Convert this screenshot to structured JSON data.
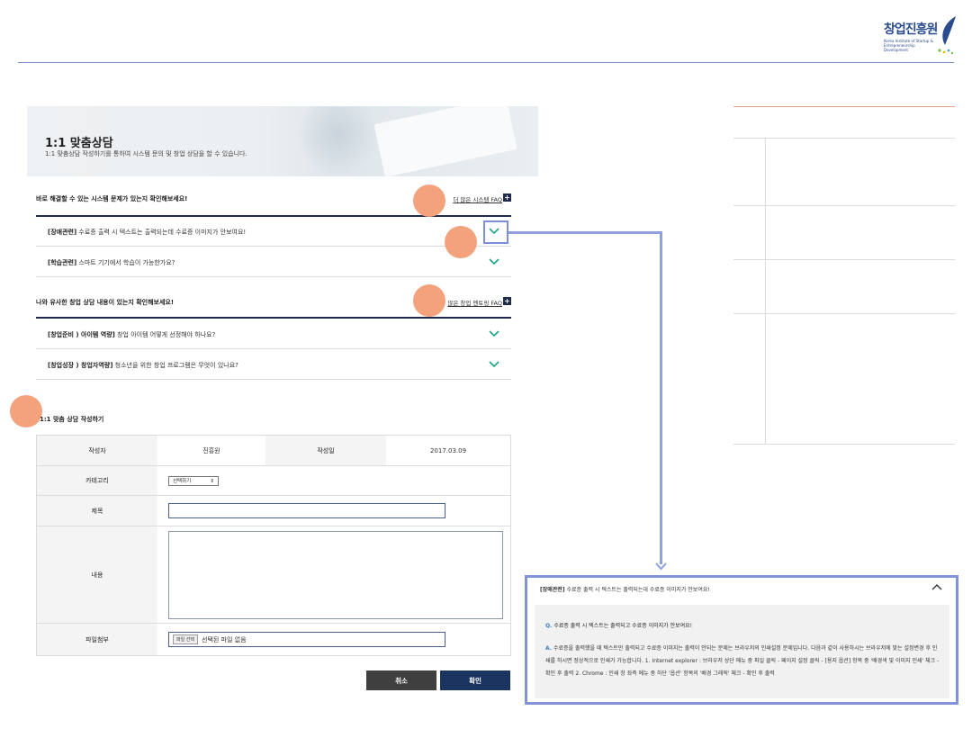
{
  "brand": {
    "logo_text": "창업진흥원",
    "logo_subtext": "Korea Institute of Startup & Entrepreneurship Development"
  },
  "banner": {
    "title": "1:1 맞춤상담",
    "description": "1:1 맞춤상담 작성하기를 통하여 시스템 문의 및 창업 상담을 할 수 있습니다."
  },
  "system_faq": {
    "heading": "바로 해결할 수 있는 시스템 문제가 있는지 확인해보세요!",
    "more_link": "더 많은 시스템 FAQ",
    "items": [
      {
        "tag": "[장애관련]",
        "text": "수료증 출력 시 텍스트는 출력되는데 수료증 이미지가 안보여요!"
      },
      {
        "tag": "[학습관련]",
        "text": "스마트 기기에서 학습이 가능한가요?"
      }
    ]
  },
  "mentoring_faq": {
    "heading": "나와 유사한 창업 상담 내용이 있는지 확인해보세요!",
    "more_link": "많은 창업 멘토링 FAQ",
    "items": [
      {
        "tag": "[창업준비 ) 아이템 역량]",
        "text": "창업 아이템 어떻게 선정해야 하나요?"
      },
      {
        "tag": "[창업성장 ) 창업자역량]",
        "text": "청소년을 위한 창업 프로그램은 무엇이 있나요?"
      }
    ]
  },
  "form": {
    "title": "1:1 맞춤 상담 작성하기",
    "author_label": "작성자",
    "author_value": "진흥원",
    "date_label": "작성일",
    "date_value": "2017.03.09",
    "category_label": "카테고리",
    "category_selected": "선택하기",
    "subject_label": "제목",
    "content_label": "내용",
    "file_label": "파일첨부",
    "file_button": "파일 선택",
    "file_status": "선택된 파일 없음",
    "cancel_label": "취소",
    "confirm_label": "확인"
  },
  "popup": {
    "header_tag": "[장애관련]",
    "header_text": "수료증 출력 시 텍스트는 출력되는데 수료증 이미지가 안보여요!",
    "q_marker": "Q.",
    "question": "수료증 출력 시 텍스트는 출력되고 수료증 이미지가 안보여요!",
    "a_marker": "A.",
    "answer": "수료증을 출력했을 때 텍스트만 출력되고 수료증 이미지는 출력이 안되는 문제는 브라우저의 인쇄설정 문제입니다. 다음과 같이 사용하시는 브라우저에 맞는 설정변경 후 인쇄를 하시면 정상적으로 인쇄가 가능합니다. 1. Internet explorer : 브라우저 상단 메뉴 중 파일 클릭 - 페이지 설정 클릭 - [용지 옵션] 항목 중 '배경색 및 이미지 인쇄' 체크 - 확인 후 출력 2. Chrome : 인쇄 창 좌측 메뉴 중 하단 '옵션' 항목의 '배경 그래픽' 체크 - 확인 후 출력"
  },
  "icons": {
    "plus": "plus-icon",
    "chevron_down": "chevron-down-icon",
    "chevron_up": "chevron-up-icon",
    "select_arrow": "select-arrows-icon"
  },
  "colors": {
    "navy": "#1e2b4a",
    "accent_teal": "#1aa58a",
    "annotation": "#8193d6",
    "marker": "#f3a27c"
  }
}
